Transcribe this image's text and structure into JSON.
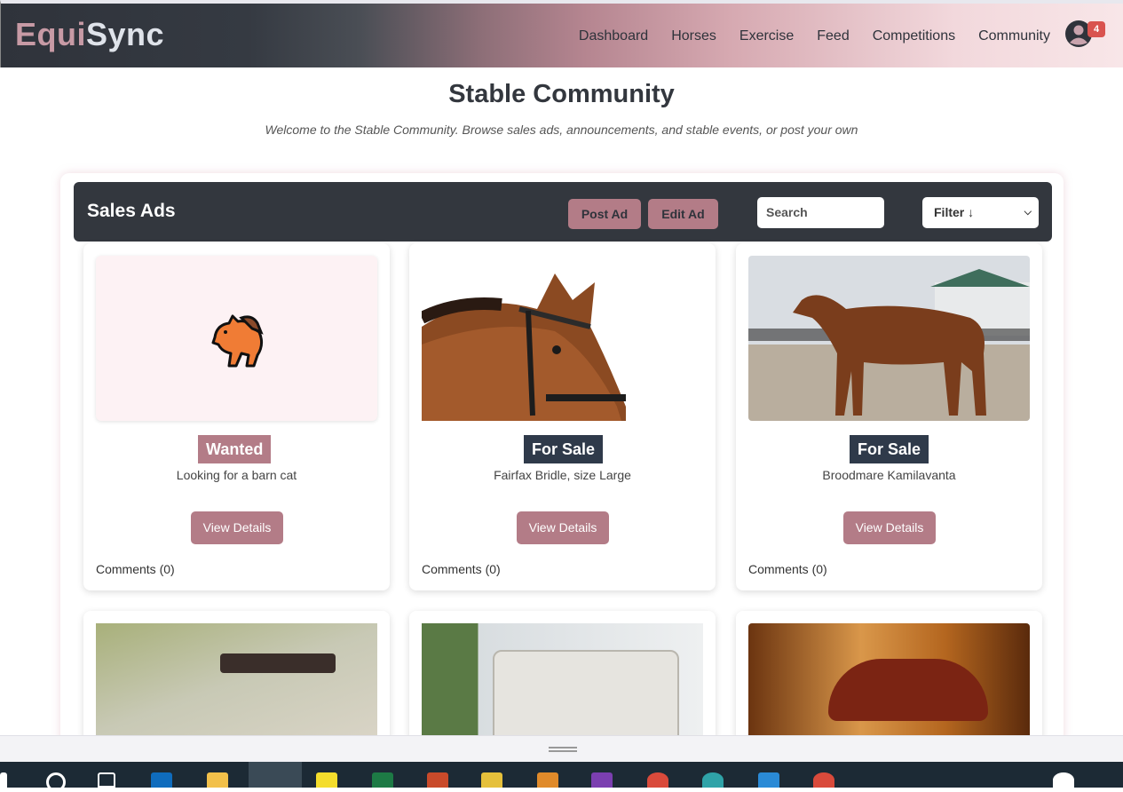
{
  "app": {
    "logo_part1": "Equi",
    "logo_part2": "Sync"
  },
  "nav": {
    "items": [
      "Dashboard",
      "Horses",
      "Exercise",
      "Feed",
      "Competitions",
      "Community"
    ],
    "notification_count": "4"
  },
  "page": {
    "title": "Stable Community",
    "subtitle": "Welcome to the Stable Community. Browse sales ads, announcements, and stable events, or post your own"
  },
  "toolbar": {
    "title": "Sales Ads",
    "post_label": "Post Ad",
    "edit_label": "Edit Ad",
    "search_placeholder": "Search",
    "filter_label": "Filter ↓"
  },
  "cards": [
    {
      "tag": "Wanted",
      "description": "Looking for a barn cat",
      "button": "View Details",
      "comments": "Comments (0)",
      "image": "horse-emoji-icon"
    },
    {
      "tag": "For Sale",
      "description": "Fairfax Bridle, size Large",
      "button": "View Details",
      "comments": "Comments (0)",
      "image": "horse-bridle-photo"
    },
    {
      "tag": "For Sale",
      "description": "Broodmare Kamilavanta",
      "button": "View Details",
      "comments": "Comments (0)",
      "image": "bay-mare-photo"
    }
  ],
  "colors": {
    "accent": "#b37c87",
    "dark": "#33373e",
    "sale_tag": "#2f3a4a"
  }
}
